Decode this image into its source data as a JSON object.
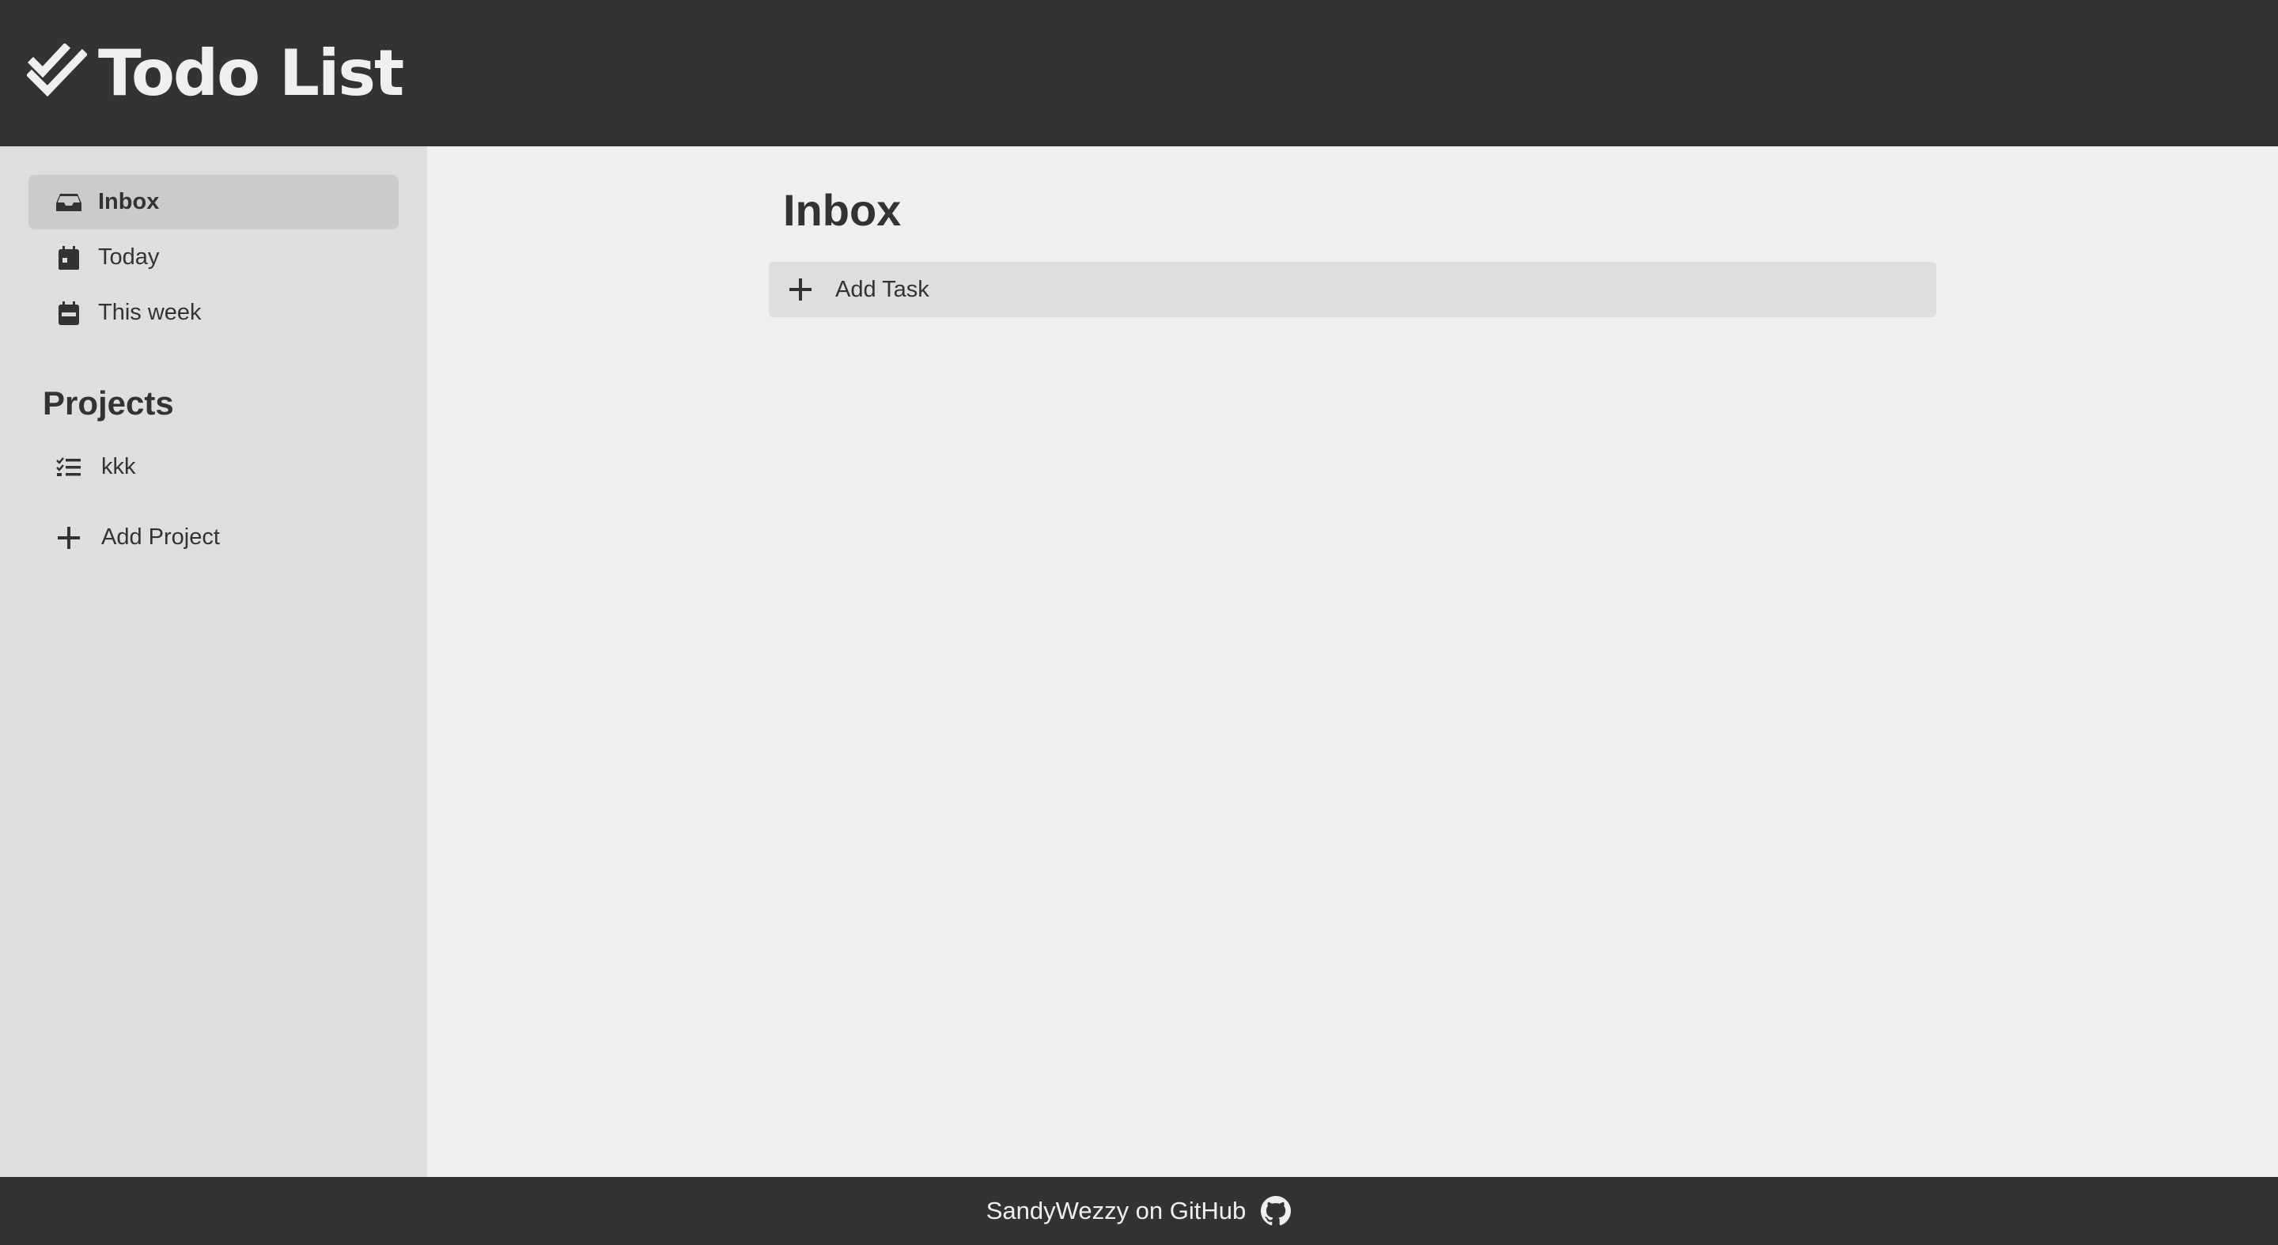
{
  "header": {
    "title": "Todo List",
    "logo_icon": "double-check-icon"
  },
  "sidebar": {
    "nav_items": [
      {
        "label": "Inbox",
        "icon": "inbox-icon",
        "active": true
      },
      {
        "label": "Today",
        "icon": "calendar-day-icon",
        "active": false
      },
      {
        "label": "This week",
        "icon": "calendar-week-icon",
        "active": false
      }
    ],
    "projects_heading": "Projects",
    "projects": [
      {
        "label": "kkk",
        "icon": "list-check-icon"
      }
    ],
    "add_project_label": "Add Project"
  },
  "main": {
    "title": "Inbox",
    "add_task_label": "Add Task"
  },
  "footer": {
    "link_text": "SandyWezzy on GitHub",
    "icon": "github-icon"
  },
  "colors": {
    "header_bg": "#333333",
    "sidebar_bg": "#dedede",
    "main_bg": "#efefef",
    "active_item_bg": "#cbcbcb",
    "text": "#333333"
  }
}
